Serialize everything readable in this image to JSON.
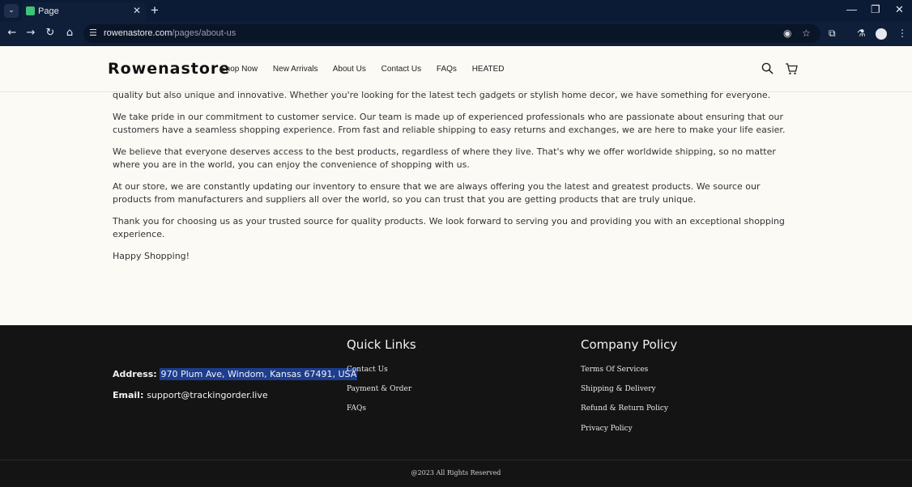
{
  "browser": {
    "tab_title": "Page",
    "url_host": "rowenastore.com",
    "url_path": "/pages/about-us",
    "new_tab_icon": "+",
    "close_tab_icon": "✕"
  },
  "site": {
    "logo": "Rowenastore",
    "nav": [
      "Shop Now",
      "New Arrivals",
      "About Us",
      "Contact Us",
      "FAQs",
      "HEATED"
    ]
  },
  "content": {
    "paragraphs": [
      "quality but also unique and innovative. Whether you're looking for the latest tech gadgets or stylish home decor, we have something for everyone.",
      "We take pride in our commitment to customer service. Our team is made up of experienced professionals who are passionate about ensuring that our customers have a seamless shopping experience. From fast and reliable shipping to easy returns and exchanges, we are here to make your life easier.",
      "We believe that everyone deserves access to the best products, regardless of where they live. That's why we offer worldwide shipping, so no matter where you are in the world, you can enjoy the convenience of shopping with us.",
      "At our store, we are constantly updating our inventory to ensure that we are always offering you the latest and greatest products. We source our products from manufacturers and suppliers all over the world, so you can trust that you are getting products that are truly unique.",
      "Thank you for choosing us as your trusted source for quality products. We look forward to serving you and providing you with an exceptional shopping experience.",
      "Happy Shopping!"
    ]
  },
  "footer": {
    "address_label": "Address:",
    "address_value": "970 Plum Ave, Windom, Kansas 67491, USA",
    "email_label": "Email:",
    "email_value": "support@trackingorder.live",
    "quick_links_title": "Quick Links",
    "quick_links": [
      "Contact Us",
      "Payment & Order",
      "FAQs"
    ],
    "policy_title": "Company Policy",
    "policy_links": [
      "Terms Of Services",
      "Shipping & Delivery",
      "Refund & Return Policy",
      "Privacy Policy"
    ],
    "copyright": "@2023 All Rights Reserved"
  }
}
